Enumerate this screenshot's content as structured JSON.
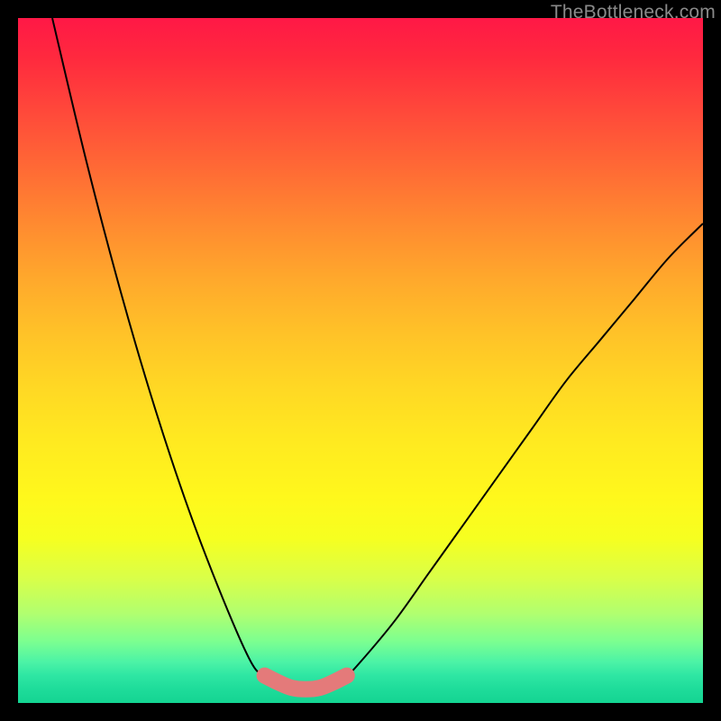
{
  "watermark": "TheBottleneck.com",
  "chart_data": {
    "type": "line",
    "title": "",
    "xlabel": "",
    "ylabel": "",
    "xlim": [
      0,
      100
    ],
    "ylim": [
      0,
      100
    ],
    "grid": false,
    "legend": false,
    "series": [
      {
        "name": "left-curve",
        "x": [
          5,
          10,
          15,
          20,
          25,
          30,
          34,
          36,
          38
        ],
        "values": [
          100,
          79,
          60,
          43,
          28,
          15,
          6,
          4,
          3
        ]
      },
      {
        "name": "right-curve",
        "x": [
          46,
          48,
          50,
          55,
          60,
          65,
          70,
          75,
          80,
          85,
          90,
          95,
          100
        ],
        "values": [
          3,
          4,
          6,
          12,
          19,
          26,
          33,
          40,
          47,
          53,
          59,
          65,
          70
        ]
      },
      {
        "name": "highlight-band",
        "x": [
          36,
          38,
          40,
          42,
          44,
          46,
          48
        ],
        "values": [
          4,
          3,
          2.2,
          2,
          2.2,
          3,
          4
        ],
        "stroke": "#e47a7a",
        "width": 18,
        "cap": "round"
      }
    ],
    "annotations": []
  }
}
